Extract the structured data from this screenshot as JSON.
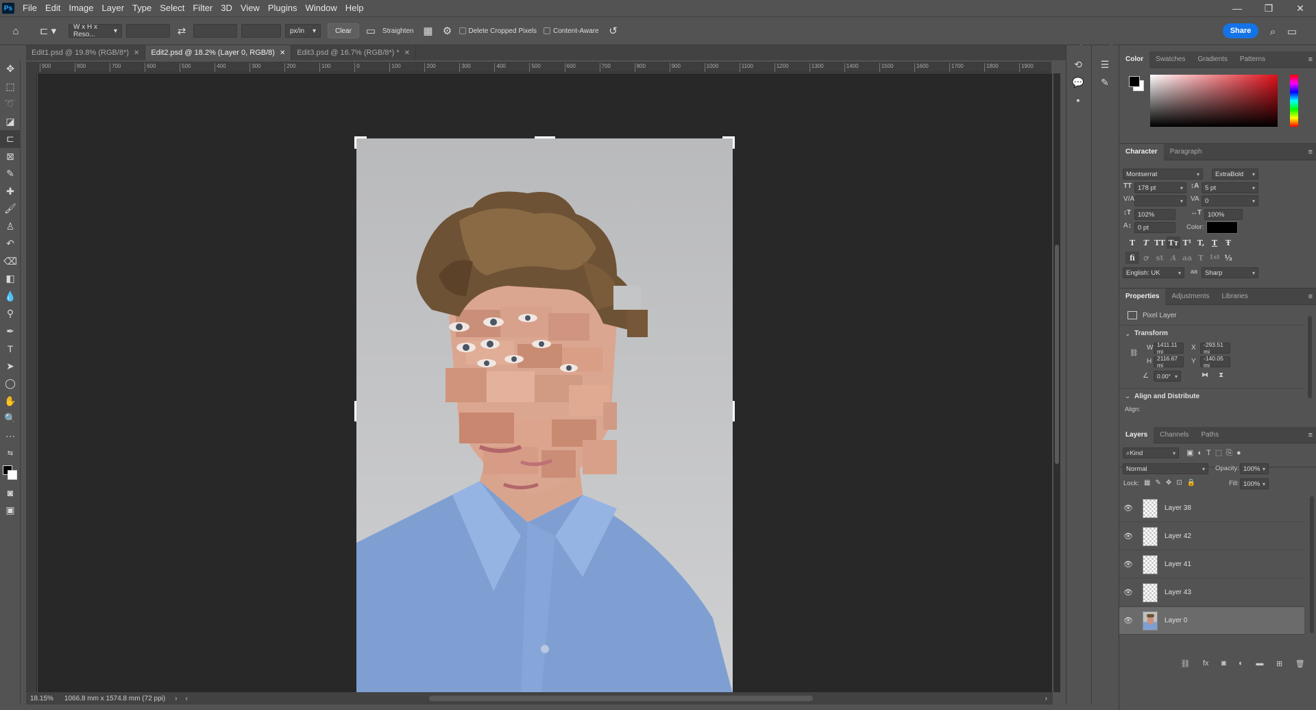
{
  "app": {
    "logo": "Ps"
  },
  "menu": [
    "File",
    "Edit",
    "Image",
    "Layer",
    "Type",
    "Select",
    "Filter",
    "3D",
    "View",
    "Plugins",
    "Window",
    "Help"
  ],
  "window_controls": {
    "minimize": "—",
    "restore": "❐",
    "close": "✕"
  },
  "options_bar": {
    "ratio_preset": "W x H x Reso...",
    "unit": "px/in",
    "clear_label": "Clear",
    "straighten_label": "Straighten",
    "delete_cropped_label": "Delete Cropped Pixels",
    "content_aware_label": "Content-Aware",
    "share_label": "Share"
  },
  "doc_tabs": [
    {
      "label": "Edit1.psd @ 19.8% (RGB/8*)",
      "active": false
    },
    {
      "label": "Edit2.psd @ 18.2% (Layer 0, RGB/8)",
      "active": true
    },
    {
      "label": "Edit3.psd @ 16.7% (RGB/8*) *",
      "active": false
    }
  ],
  "ruler_ticks": [
    "900",
    "800",
    "700",
    "600",
    "500",
    "400",
    "300",
    "200",
    "100",
    "0",
    "100",
    "200",
    "300",
    "400",
    "500",
    "600",
    "700",
    "800",
    "900",
    "1000",
    "1100",
    "1200",
    "1300",
    "1400",
    "1500",
    "1600",
    "1700",
    "1800",
    "1900"
  ],
  "status": {
    "zoom": "18.15%",
    "doc_size": "1066.8 mm x 1574.8 mm (72 ppi)"
  },
  "color_panel": {
    "tabs": [
      "Color",
      "Swatches",
      "Gradients",
      "Patterns"
    ],
    "active": "Color",
    "fg": "#000000",
    "bg": "#ffffff",
    "hue_base": "#e0101a"
  },
  "character": {
    "tabs": [
      "Character",
      "Paragraph"
    ],
    "font_family": "Montserrat",
    "font_style": "ExtraBold",
    "size": "178 pt",
    "leading": "5 pt",
    "kerning": "",
    "tracking": "0",
    "vscale": "102%",
    "hscale": "100%",
    "baseline": "0 pt",
    "color_label": "Color:",
    "language": "English: UK",
    "aa_label": "aa",
    "antialias": "Sharp",
    "style_glyphs": [
      "T",
      "T",
      "TT",
      "Tт",
      "T¹",
      "T,",
      "T",
      "Ŧ"
    ],
    "otf_glyphs": [
      "fi",
      "ꝍ",
      "st",
      "A",
      "aa",
      "T",
      "1st",
      "½"
    ]
  },
  "properties": {
    "tabs": [
      "Properties",
      "Adjustments",
      "Libraries"
    ],
    "kind": "Pixel Layer",
    "transform_label": "Transform",
    "w_label": "W",
    "w": "1411.11 mi",
    "x_label": "X",
    "x": "-293.51 mi",
    "h_label": "H",
    "h": "2116.67 mi",
    "y_label": "Y",
    "y": "-140.05 mi",
    "angle": "0.00°",
    "align_label": "Align and Distribute",
    "align_sub": "Align:"
  },
  "layers_panel": {
    "tabs": [
      "Layers",
      "Channels",
      "Paths"
    ],
    "filter": "Kind",
    "blend": "Normal",
    "opacity_label": "Opacity:",
    "opacity": "100%",
    "lock_label": "Lock:",
    "fill_label": "Fill:",
    "fill": "100%",
    "layers": [
      {
        "name": "Layer 38",
        "selected": false
      },
      {
        "name": "Layer 42",
        "selected": false
      },
      {
        "name": "Layer 41",
        "selected": false
      },
      {
        "name": "Layer 43",
        "selected": false
      },
      {
        "name": "Layer 0",
        "selected": true
      }
    ]
  }
}
